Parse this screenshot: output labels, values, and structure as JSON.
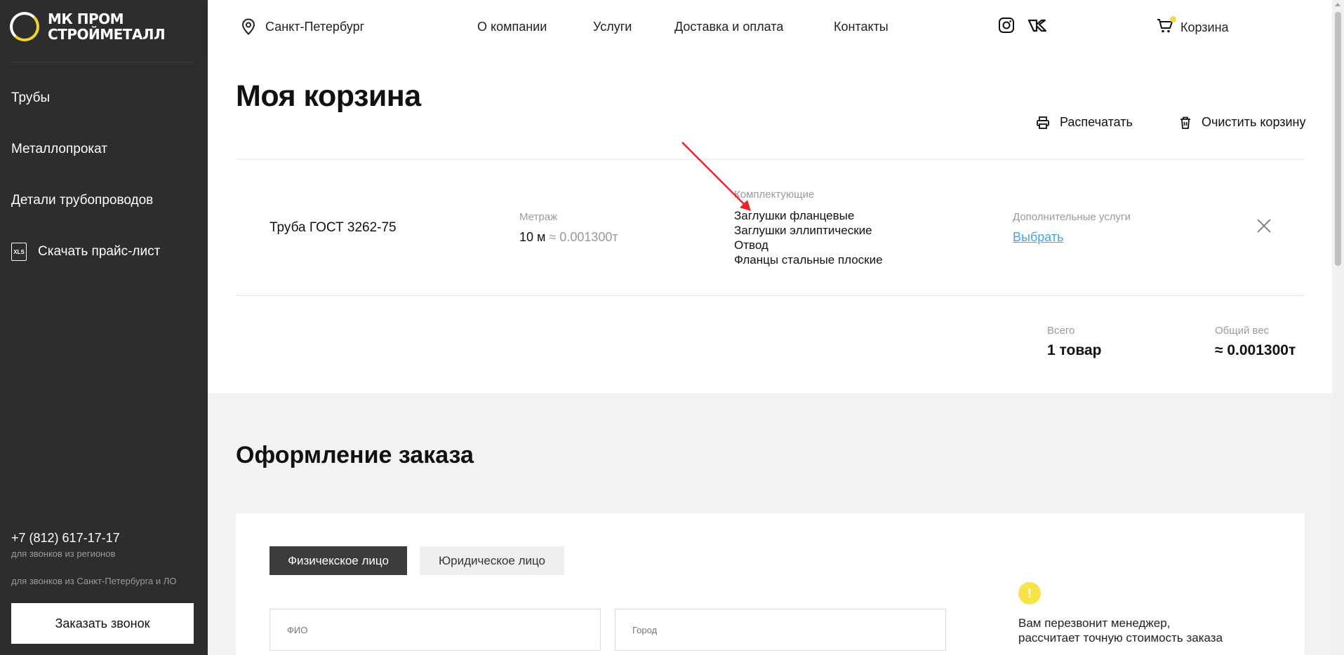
{
  "sidebar": {
    "logo_line1": "МК ПРОМ",
    "logo_line2": "СТРОЙМЕТАЛЛ",
    "menu": [
      "Трубы",
      "Металлопрокат",
      "Детали трубопроводов"
    ],
    "download_label": "Скачать прайс-лист",
    "xls_icon_text": "XLS",
    "phone": "+7 (812) 617-17-17",
    "phone_note_regions": "для звонков из регионов",
    "phone_note_spb": "для звонков из Санкт-Петербурга и ЛО",
    "callback_label": "Заказать звонок"
  },
  "header": {
    "city": "Санкт-Петербург",
    "nav": [
      "О компании",
      "Услуги",
      "Доставка и оплата",
      "Контакты"
    ],
    "social_icons": [
      "instagram-icon",
      "vk-icon"
    ],
    "cart_label": "Корзина"
  },
  "cart": {
    "title": "Моя корзина",
    "print_label": "Распечатать",
    "clear_label": "Очистить корзину",
    "item": {
      "name": "Труба ГОСТ 3262-75",
      "meter_label": "Метраж",
      "meter_value": "10 м",
      "weight_approx": "≈ 0.001300т",
      "accessories_label": "Комплектующие",
      "accessories": [
        "Заглушки фланцевые",
        "Заглушки эллиптические",
        "Отвод",
        "Фланцы стальные плоские"
      ],
      "services_label": "Дополнительные услуги",
      "services_link": "Выбрать"
    },
    "total_label": "Всего",
    "total_value": "1 товар",
    "weight_label": "Общий вес",
    "weight_value": "≈ 0.001300т"
  },
  "checkout": {
    "title": "Оформление заказа",
    "tabs": [
      "Физичекское лицо",
      "Юридическое лицо"
    ],
    "fio_placeholder": "ФИО",
    "city_placeholder": "Город",
    "info_icon": "!",
    "info_text": "Вам перезвонит менеджер, рассчитает точную стоимость заказа"
  },
  "colors": {
    "sidebar_bg": "#2d2d2d",
    "accent_yellow": "#f2d22e",
    "link_blue": "#4aa3df",
    "annotation_red": "#e8262b"
  }
}
